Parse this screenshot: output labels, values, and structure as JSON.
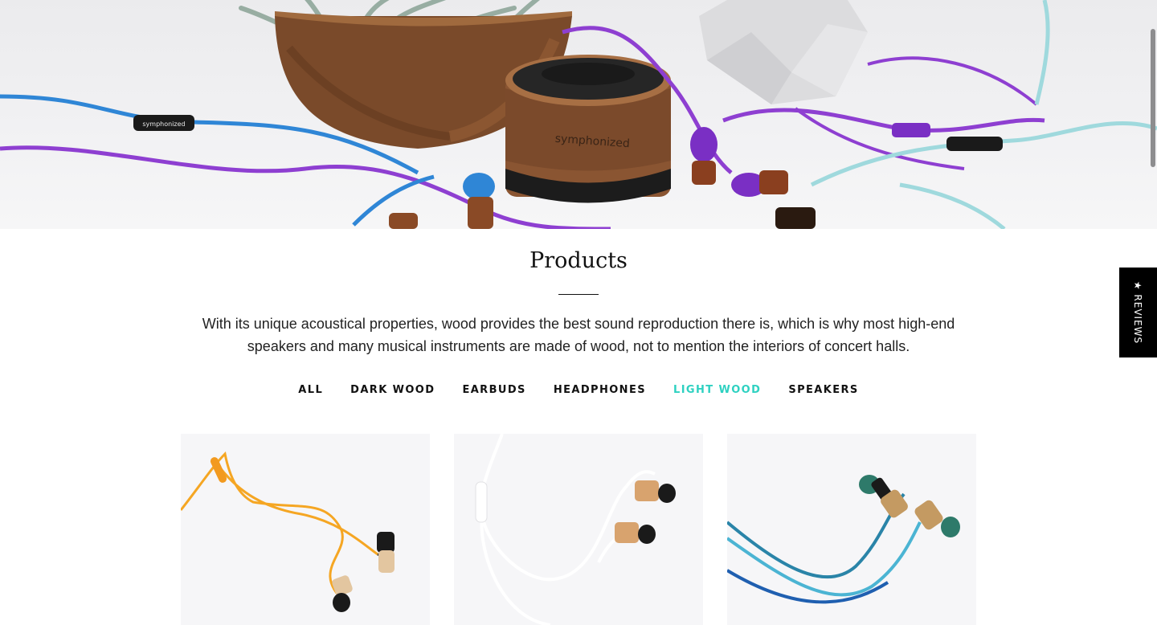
{
  "hero": {
    "brand_print": "symphonized",
    "cable_brand_print": "symphonized"
  },
  "reviews_tab": {
    "label": "★ REVIEWS"
  },
  "page": {
    "title": "Products",
    "description": "With its unique acoustical properties, wood provides the best sound reproduction there is, which is why most high-end speakers and many musical instruments are made of wood, not to mention the interiors of concert halls."
  },
  "filters": {
    "items": [
      {
        "label": "ALL",
        "active": false
      },
      {
        "label": "DARK WOOD",
        "active": false
      },
      {
        "label": "EARBUDS",
        "active": false
      },
      {
        "label": "HEADPHONES",
        "active": false
      },
      {
        "label": "LIGHT WOOD",
        "active": true
      },
      {
        "label": "SPEAKERS",
        "active": false
      }
    ],
    "active_color": "#2ed1c1"
  },
  "products": [
    {
      "cable_color": "#f5a623",
      "icon": "orange-earbuds-image"
    },
    {
      "cable_color": "#ffffff",
      "icon": "white-earbuds-image"
    },
    {
      "cable_color": "#3aa7c9",
      "icon": "blue-earbuds-image"
    }
  ]
}
